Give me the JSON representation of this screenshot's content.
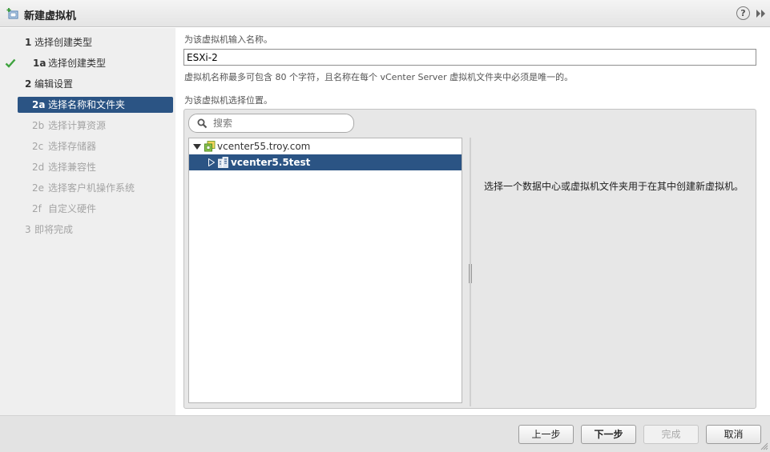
{
  "window": {
    "title": "新建虚拟机",
    "icon": "new-vm-icon",
    "help_label": "?",
    "expand_icon": "double-chevron-right-icon"
  },
  "steps": [
    {
      "num": "1",
      "label": "选择创建类型",
      "state": "section"
    },
    {
      "num": "1a",
      "label": "选择创建类型",
      "state": "done"
    },
    {
      "num": "2",
      "label": "编辑设置",
      "state": "section"
    },
    {
      "num": "2a",
      "label": "选择名称和文件夹",
      "state": "active"
    },
    {
      "num": "2b",
      "label": "选择计算资源",
      "state": "disabled"
    },
    {
      "num": "2c",
      "label": "选择存储器",
      "state": "disabled"
    },
    {
      "num": "2d",
      "label": "选择兼容性",
      "state": "disabled"
    },
    {
      "num": "2e",
      "label": "选择客户机操作系统",
      "state": "disabled"
    },
    {
      "num": "2f",
      "label": "自定义硬件",
      "state": "disabled"
    },
    {
      "num": "3",
      "label": "即将完成",
      "state": "disabled"
    }
  ],
  "main": {
    "name_prompt": "为该虚拟机输入名称。",
    "name_value": "ESXi-2",
    "name_hint": "虚拟机名称最多可包含 80 个字符，且名称在每个 vCenter Server 虚拟机文件夹中必须是唯一的。",
    "location_prompt": "为该虚拟机选择位置。",
    "search_placeholder": "搜索",
    "tree": {
      "root": "vcenter55.troy.com",
      "child": "vcenter5.5test"
    },
    "info_text": "选择一个数据中心或虚拟机文件夹用于在其中创建新虚拟机。"
  },
  "footer": {
    "back": "上一步",
    "next": "下一步",
    "finish": "完成",
    "cancel": "取消"
  },
  "colors": {
    "accent": "#2b5484",
    "check": "#3fa33f",
    "sidebar_bg": "#efefef",
    "panel_bg": "#e7e7e7"
  }
}
